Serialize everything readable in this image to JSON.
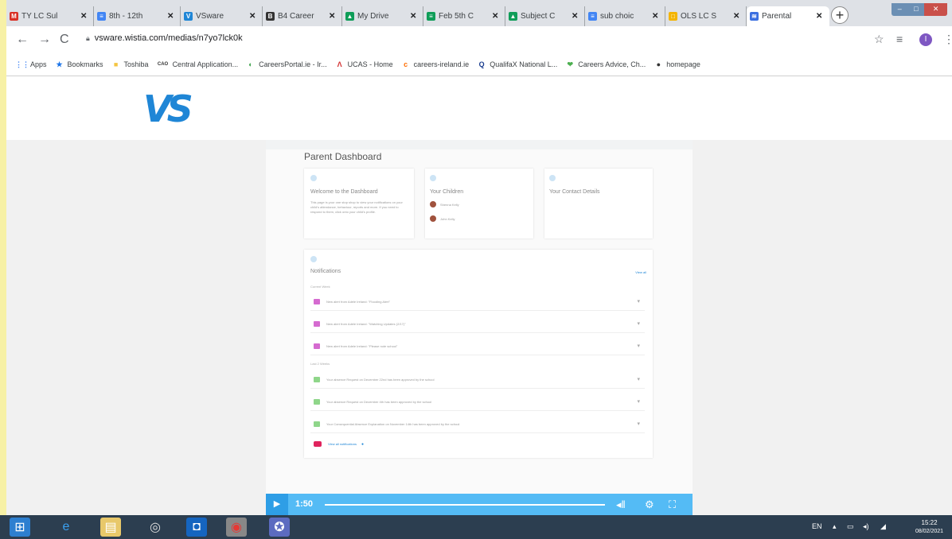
{
  "browser": {
    "tabs": [
      {
        "title": "TY LC Sul",
        "icon": "gmail-icon",
        "color": "#d93025",
        "glyph": "M"
      },
      {
        "title": "8th - 12th",
        "icon": "docs-icon",
        "color": "#4285f4",
        "glyph": "≡"
      },
      {
        "title": "VSware",
        "icon": "vsware-icon",
        "color": "#1f86d6",
        "glyph": "V"
      },
      {
        "title": "B4 Career",
        "icon": "careers-icon",
        "color": "#333333",
        "glyph": "B"
      },
      {
        "title": "My Drive",
        "icon": "drive-icon",
        "color": "#0f9d58",
        "glyph": "▲"
      },
      {
        "title": "Feb 5th C",
        "icon": "sheets-icon",
        "color": "#0f9d58",
        "glyph": "≡"
      },
      {
        "title": "Subject C",
        "icon": "drive-icon",
        "color": "#0f9d58",
        "glyph": "▲"
      },
      {
        "title": "sub choic",
        "icon": "docs-icon",
        "color": "#4285f4",
        "glyph": "≡"
      },
      {
        "title": "OLS LC S",
        "icon": "slides-icon",
        "color": "#f4b400",
        "glyph": "□"
      },
      {
        "title": "Parental",
        "icon": "wistia-icon",
        "color": "#3b6fe0",
        "glyph": "≋",
        "active": true
      }
    ],
    "new_tab": "+",
    "url": "vsware.wistia.com/medias/n7yo7lck0k",
    "profile_initial": "I"
  },
  "bookmarks": [
    {
      "label": "Apps",
      "icon": "apps-grid-icon",
      "color": "#4285f4",
      "glyph": "⋮⋮"
    },
    {
      "label": "Bookmarks",
      "icon": "star-icon",
      "color": "#1a73e8",
      "glyph": "★"
    },
    {
      "label": "Toshiba",
      "icon": "folder-icon",
      "color": "#f4c542",
      "glyph": "■"
    },
    {
      "label": "Central Application...",
      "icon": "cao-icon",
      "color": "#333333",
      "glyph": "CAO"
    },
    {
      "label": "CareersPortal.ie - Ir...",
      "icon": "careersportal-icon",
      "color": "#3fa34d",
      "glyph": "◐"
    },
    {
      "label": "UCAS - Home",
      "icon": "ucas-icon",
      "color": "#d32f2f",
      "glyph": "Λ"
    },
    {
      "label": "careers-ireland.ie",
      "icon": "careers-ireland-icon",
      "color": "#ff6d00",
      "glyph": "c"
    },
    {
      "label": "QualifaX National L...",
      "icon": "qualifax-icon",
      "color": "#1a3d8f",
      "glyph": "Q"
    },
    {
      "label": "Careers Advice, Ch...",
      "icon": "careers-advice-icon",
      "color": "#4caf50",
      "glyph": "❤"
    },
    {
      "label": "homepage",
      "icon": "github-icon",
      "color": "#333333",
      "glyph": "●"
    }
  ],
  "site": {
    "logo": "VS"
  },
  "video": {
    "dashboard_title": "Parent Dashboard",
    "cards": {
      "welcome": {
        "title": "Welcome to the Dashboard",
        "text": "This page is your one stop shop to view your notifications on your child's attendance, behaviour, reports and more. If you need to respond to them, click onto your child's profile."
      },
      "children": {
        "title": "Your Children",
        "items": [
          "Shenna Kelly",
          "John Kelly"
        ]
      },
      "contact": {
        "title": "Your Contact Details"
      }
    },
    "notifications": {
      "title": "Notifications",
      "view_all": "View all",
      "group1": "Current Week",
      "group1_items": [
        "New alert from Adele Ireland: \"Flooding Alert\"",
        "New alert from Adele Ireland: \"Watching Updates (2/17)\"",
        "New alert from Adele Ireland: \"Please note school\""
      ],
      "group2": "Last 2 Weeks",
      "group2_items": [
        "Your absence Request on December 22nd has been approved by the school",
        "Your absence Request on December 4th has been approved by the school",
        "Your Consequential Absence Explanation on November 14th has been approved by the school"
      ],
      "footer": "View all notifications"
    },
    "time": "1:50",
    "controls": {
      "volume": "volume-icon",
      "settings": "settings-icon",
      "fullscreen": "fullscreen-icon"
    }
  },
  "taskbar": {
    "apps": [
      "windows-start-icon",
      "internet-explorer-icon",
      "file-explorer-icon",
      "media-player-icon",
      "outlook-icon",
      "chrome-icon",
      "app-icon"
    ],
    "lang": "EN",
    "time": "15:22",
    "date": "08/02/2021"
  }
}
